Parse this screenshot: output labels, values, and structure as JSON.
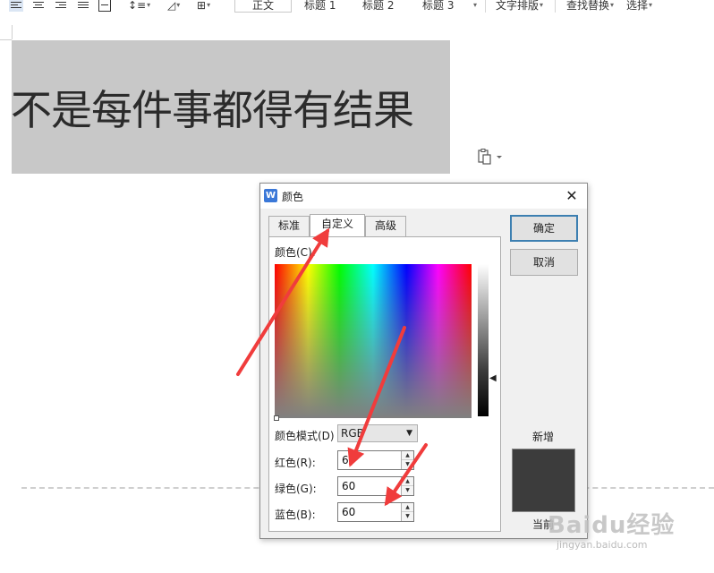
{
  "toolbar": {
    "styles": [
      "正文",
      "标题 1",
      "标题 2",
      "标题 3"
    ],
    "text_layout": "文字排版",
    "find_replace": "查找替换",
    "select": "选择"
  },
  "document": {
    "heading_text": "不是每件事都得有结果"
  },
  "dialog": {
    "title": "颜色",
    "app_icon": "W",
    "close": "✕",
    "tabs": [
      "标准",
      "自定义",
      "高级"
    ],
    "color_label": "颜色(C):",
    "color_model_label": "颜色模式(D)",
    "color_model_value": "RGB",
    "red_label": "红色(R):",
    "red_value": "60",
    "green_label": "绿色(G):",
    "green_value": "60",
    "blue_label": "蓝色(B):",
    "blue_value": "60",
    "ok": "确定",
    "cancel": "取消",
    "new_label": "新增",
    "current_label": "当前",
    "new_color": "#3c3c3c"
  },
  "watermark": {
    "brand": "Baidu经验",
    "url": "jingyan.baidu.com"
  },
  "colors": {
    "highlight": "#c8c8c8",
    "annotation_arrow": "#f03c3c",
    "primary_border": "#3c7fb1"
  }
}
